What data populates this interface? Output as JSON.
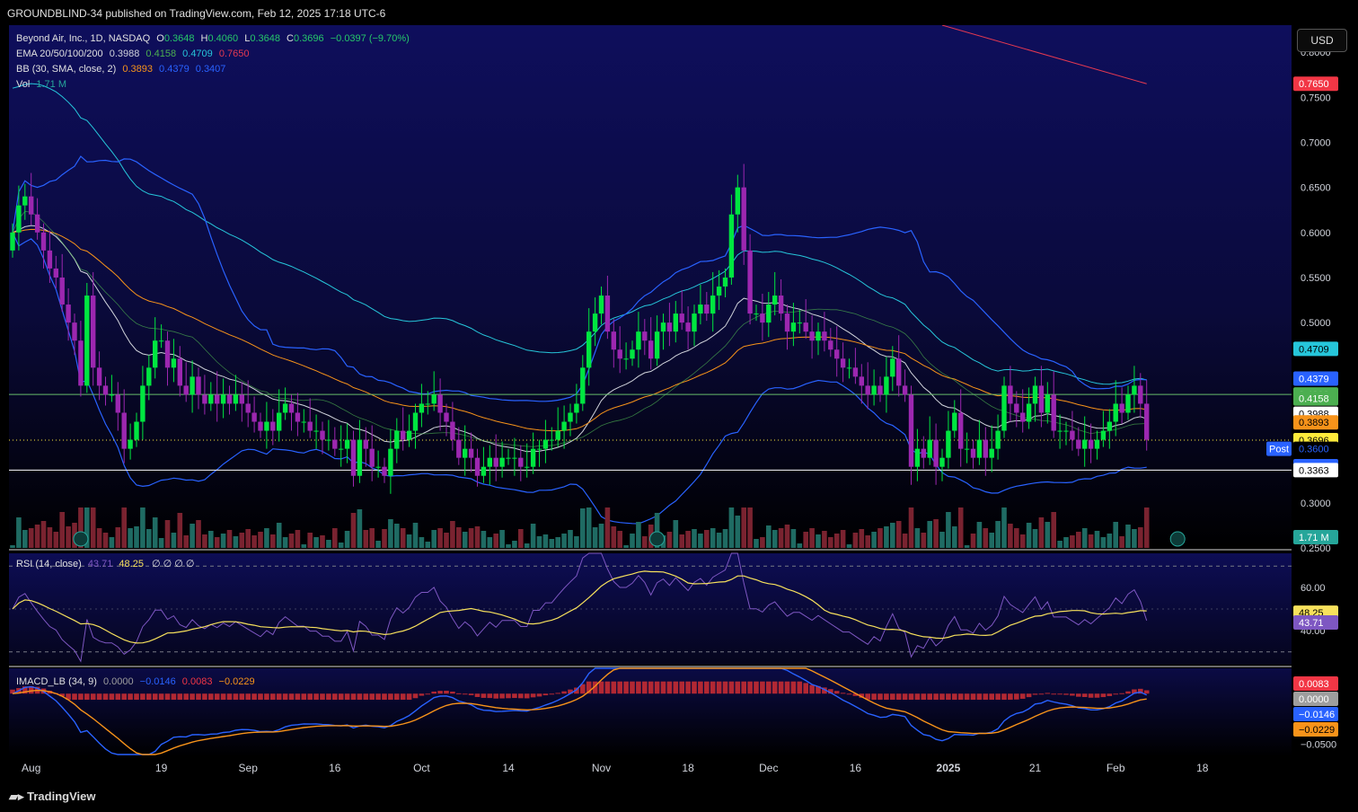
{
  "header": {
    "published": "GROUNDBLIND-34 published on TradingView.com, Feb 12, 2025 17:18 UTC-6"
  },
  "currency_button": "USD",
  "footer": {
    "brand": "TradingView"
  },
  "colors": {
    "up": "#00e640",
    "down": "#9c27b0",
    "ema20": "#d1d4dc",
    "ema50": "#f7931a",
    "ema100": "#26c6da",
    "ema200": "#e53950",
    "bb": "#2962ff",
    "rsi": "#7e57c2",
    "rsi_ma": "#f7e15c",
    "hist_up": "#b22833",
    "macd": "#2962ff",
    "signal": "#f7931a"
  },
  "legend": {
    "symbol": "Beyond Air, Inc., 1D, NASDAQ",
    "o_label": "O",
    "o": "0.3648",
    "h_label": "H",
    "h": "0.4060",
    "l_label": "L",
    "l": "0.3648",
    "c_label": "C",
    "c": "0.3696",
    "chg": "−0.0397 (−9.70%)",
    "ema_label": "EMA 20/50/100/200",
    "ema20": "0.3988",
    "ema50": "0.4158",
    "ema100": "0.4709",
    "ema200": "0.7650",
    "bb_label": "BB (30, SMA, close, 2)",
    "bb_mid": "0.3893",
    "bb_up": "0.4379",
    "bb_low": "0.3407",
    "vol_label": "Vol",
    "vol": "1.71 M",
    "rsi_label": "RSI (14, close)",
    "rsi": "43.71",
    "rsi_ma": "48.25",
    "rsi_na": "∅ ∅ ∅ ∅",
    "macd_label": "IMACD_LB (34, 9)",
    "macd_zero": "0.0000",
    "macd": "−0.0146",
    "macd_hist": "0.0083",
    "macd_signal": "−0.0229"
  },
  "price_axis": {
    "ticks": [
      "0.8000",
      "0.7500",
      "0.7000",
      "0.6500",
      "0.6000",
      "0.5500",
      "0.5000",
      "0.3000",
      "0.2500"
    ],
    "ticks_values": [
      0.8,
      0.75,
      0.7,
      0.65,
      0.6,
      0.55,
      0.5,
      0.3,
      0.25
    ],
    "badges": [
      {
        "text": "0.7650",
        "value": 0.765,
        "bg": "#f23645",
        "fg": "#ffffff"
      },
      {
        "text": "0.4709",
        "value": 0.4709,
        "bg": "#26c6da",
        "fg": "#000000"
      },
      {
        "text": "0.4379",
        "value": 0.4379,
        "bg": "#2962ff",
        "fg": "#ffffff"
      },
      {
        "text": "0.4203",
        "value": 0.4203,
        "bg": "#4caf50",
        "fg": "#ffffff"
      },
      {
        "text": "0.4158",
        "value": 0.4158,
        "bg": "#4caf50",
        "fg": "#ffffff"
      },
      {
        "text": "0.3988",
        "value": 0.3988,
        "bg": "#ffffff",
        "fg": "#000000"
      },
      {
        "text": "0.3893",
        "value": 0.3893,
        "bg": "#f7931a",
        "fg": "#000000"
      },
      {
        "text": "0.3696",
        "value": 0.3696,
        "bg": "#ffeb3b",
        "fg": "#000000"
      },
      {
        "text": "0.3600",
        "value": 0.36,
        "bg": "#000000",
        "fg": "#2962ff"
      },
      {
        "text": "0.3407",
        "value": 0.3407,
        "bg": "#2962ff",
        "fg": "#ffffff"
      },
      {
        "text": "0.3363",
        "value": 0.3363,
        "bg": "#ffffff",
        "fg": "#000000"
      },
      {
        "text": "1.71 M",
        "value": 0.262,
        "bg": "#26a69a",
        "fg": "#ffffff"
      }
    ],
    "post_label": "Post"
  },
  "rsi_axis": {
    "ticks": [
      "60.00",
      "40.00"
    ],
    "ticks_values": [
      60,
      40
    ],
    "badges": [
      {
        "text": "48.25",
        "value": 48.25,
        "bg": "#f7e15c",
        "fg": "#000000"
      },
      {
        "text": "43.71",
        "value": 43.71,
        "bg": "#7e57c2",
        "fg": "#ffffff"
      }
    ]
  },
  "macd_axis": {
    "ticks": [
      "−0.0500"
    ],
    "ticks_values": [
      -0.05
    ],
    "badges": [
      {
        "text": "0.0083",
        "value": 0.0083,
        "bg": "#f23645",
        "fg": "#ffffff"
      },
      {
        "text": "0.0000",
        "value": 0.0,
        "bg": "#9e9e9e",
        "fg": "#ffffff"
      },
      {
        "text": "−0.0146",
        "value": -0.0146,
        "bg": "#2962ff",
        "fg": "#ffffff"
      },
      {
        "text": "−0.0229",
        "value": -0.0229,
        "bg": "#f7931a",
        "fg": "#000000"
      }
    ]
  },
  "time_axis": {
    "labels": [
      "Aug",
      "19",
      "Sep",
      "16",
      "Oct",
      "14",
      "Nov",
      "18",
      "Dec",
      "16",
      "2025",
      "21",
      "Feb",
      "18"
    ],
    "label_bars": [
      3,
      24,
      38,
      52,
      66,
      80,
      95,
      109,
      122,
      136,
      151,
      165,
      178,
      192
    ],
    "bold": [
      false,
      false,
      false,
      false,
      false,
      false,
      false,
      false,
      false,
      false,
      true,
      false,
      false,
      false
    ]
  },
  "chart_data": {
    "type": "candlestick",
    "start_date": "2024-07-29",
    "horizontal_lines": [
      0.4203,
      0.3363
    ],
    "dotted_lines": [
      0.3696
    ],
    "earnings_markers_bar": [
      11,
      104,
      188
    ],
    "rsi_levels": [
      70,
      30
    ],
    "candles_close": [
      0.6,
      0.63,
      0.64,
      0.62,
      0.6,
      0.58,
      0.56,
      0.55,
      0.52,
      0.5,
      0.48,
      0.43,
      0.53,
      0.45,
      0.43,
      0.42,
      0.42,
      0.4,
      0.36,
      0.37,
      0.39,
      0.43,
      0.45,
      0.48,
      0.48,
      0.45,
      0.46,
      0.43,
      0.42,
      0.44,
      0.42,
      0.41,
      0.42,
      0.41,
      0.42,
      0.41,
      0.42,
      0.41,
      0.4,
      0.39,
      0.38,
      0.39,
      0.38,
      0.4,
      0.41,
      0.4,
      0.39,
      0.39,
      0.38,
      0.38,
      0.37,
      0.37,
      0.36,
      0.36,
      0.37,
      0.33,
      0.37,
      0.36,
      0.34,
      0.34,
      0.33,
      0.36,
      0.38,
      0.37,
      0.38,
      0.4,
      0.41,
      0.41,
      0.42,
      0.4,
      0.39,
      0.37,
      0.35,
      0.36,
      0.35,
      0.33,
      0.34,
      0.35,
      0.34,
      0.35,
      0.35,
      0.35,
      0.34,
      0.34,
      0.36,
      0.36,
      0.37,
      0.37,
      0.38,
      0.39,
      0.4,
      0.41,
      0.45,
      0.49,
      0.51,
      0.53,
      0.49,
      0.47,
      0.46,
      0.46,
      0.47,
      0.49,
      0.48,
      0.46,
      0.49,
      0.5,
      0.49,
      0.51,
      0.5,
      0.49,
      0.51,
      0.52,
      0.51,
      0.53,
      0.54,
      0.55,
      0.62,
      0.65,
      0.58,
      0.51,
      0.51,
      0.5,
      0.52,
      0.53,
      0.51,
      0.49,
      0.5,
      0.5,
      0.49,
      0.48,
      0.49,
      0.48,
      0.47,
      0.46,
      0.45,
      0.45,
      0.44,
      0.43,
      0.42,
      0.43,
      0.42,
      0.44,
      0.46,
      0.43,
      0.42,
      0.34,
      0.36,
      0.35,
      0.37,
      0.34,
      0.35,
      0.38,
      0.4,
      0.36,
      0.36,
      0.35,
      0.37,
      0.35,
      0.36,
      0.38,
      0.43,
      0.41,
      0.4,
      0.39,
      0.41,
      0.43,
      0.4,
      0.42,
      0.38,
      0.38,
      0.38,
      0.37,
      0.36,
      0.37,
      0.36,
      0.37,
      0.38,
      0.39,
      0.41,
      0.4,
      0.42,
      0.43,
      0.41,
      0.37
    ],
    "price_range": [
      0.25,
      0.83
    ],
    "rsi_range": [
      24,
      76
    ],
    "macd_range": [
      -0.06,
      0.025
    ]
  }
}
